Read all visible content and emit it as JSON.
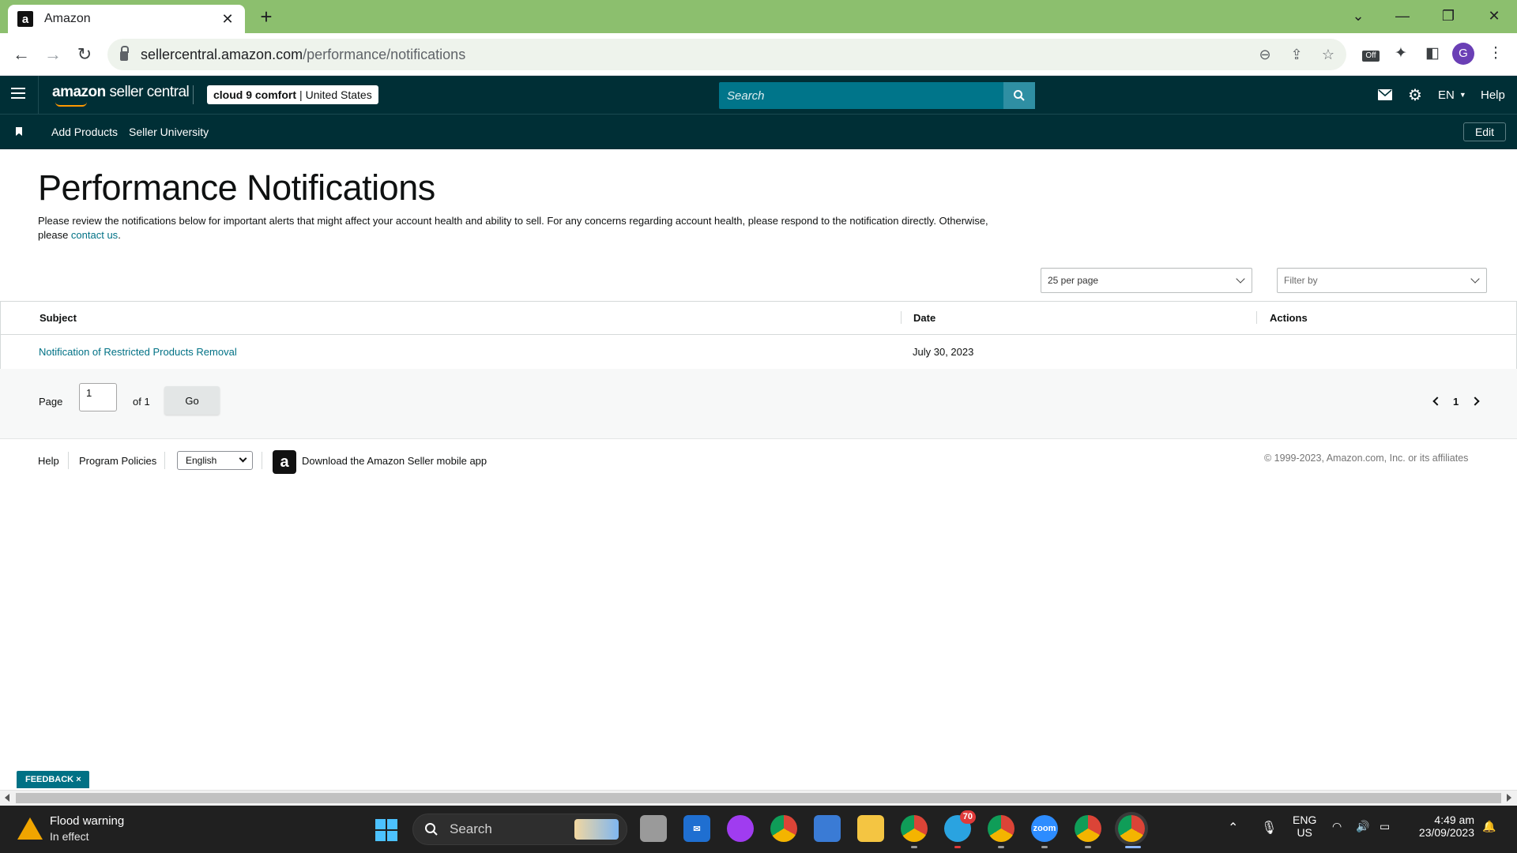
{
  "browser": {
    "tab_title": "Amazon",
    "tab_favicon": "a",
    "url_host": "sellercentral.amazon.com",
    "url_path": "/performance/notifications",
    "profile_initial": "G",
    "extension_badge": "Off"
  },
  "header": {
    "logo_amazon": "amazon",
    "logo_product": "seller central",
    "account_name": "cloud 9 comfort",
    "account_region": "United States",
    "search_placeholder": "Search",
    "language": "EN",
    "help": "Help"
  },
  "subnav": {
    "items": [
      "Add Products",
      "Seller University"
    ],
    "edit": "Edit"
  },
  "main": {
    "title": "Performance Notifications",
    "intro_before": "Please review the notifications below for important alerts that might affect your account health and ability to sell. For any concerns regarding account health, please respond to the notification directly. Otherwise, please ",
    "intro_link": "contact us",
    "intro_after": ".",
    "per_page": "25 per page",
    "filter_placeholder": "Filter by",
    "table": {
      "columns": [
        "Subject",
        "Date",
        "Actions"
      ],
      "rows": [
        {
          "subject": "Notification of Restricted Products Removal",
          "date": "July 30, 2023",
          "actions": ""
        }
      ]
    },
    "pager": {
      "page_label": "Page",
      "page_value": "1",
      "of_label": "of 1",
      "go": "Go",
      "current": "1"
    }
  },
  "footer": {
    "help": "Help",
    "program_policies": "Program Policies",
    "language": "English",
    "app_text": "Download the Amazon Seller mobile app",
    "copyright": "© 1999-2023, Amazon.com, Inc. or its affiliates"
  },
  "feedback": {
    "label": "FEEDBACK",
    "close": "×"
  },
  "taskbar": {
    "weather_title": "Flood warning",
    "weather_sub": "In effect",
    "search": "Search",
    "telegram_badge": "70",
    "zoom_label": "zoom",
    "lang_line1": "ENG",
    "lang_line2": "US",
    "time": "4:49 am",
    "date": "23/09/2023"
  },
  "colors": {
    "header_bg": "#002f36",
    "link": "#007185",
    "tabstrip": "#8cbf6e"
  }
}
